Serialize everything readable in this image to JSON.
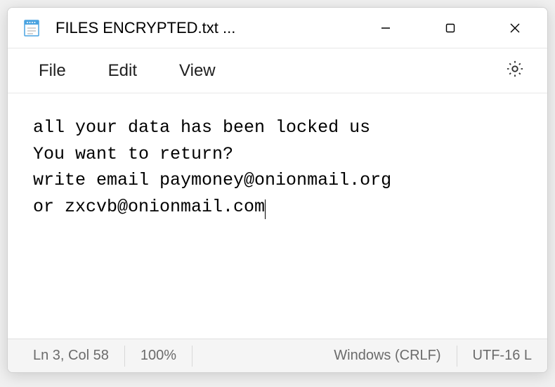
{
  "titlebar": {
    "title": "FILES ENCRYPTED.txt ..."
  },
  "menubar": {
    "file": "File",
    "edit": "Edit",
    "view": "View"
  },
  "content": {
    "line1": "all your data has been locked us",
    "line2": "You want to return?",
    "line3": "write email paymoney@onionmail.org",
    "line4": "or zxcvb@onionmail.com"
  },
  "statusbar": {
    "position": "Ln 3, Col 58",
    "zoom": "100%",
    "lineending": "Windows (CRLF)",
    "encoding": "UTF-16 L"
  }
}
